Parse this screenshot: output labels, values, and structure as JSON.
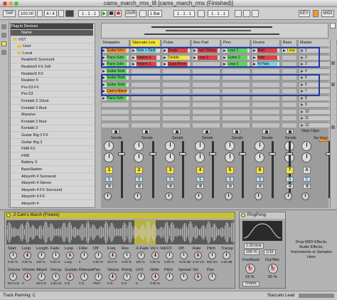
{
  "window": {
    "title": "cams_march_rmx_l8  [cams_march_rmx (Finished)]"
  },
  "control": {
    "tap": "TAP",
    "tempo": "100.00",
    "sig": "4 / 4",
    "pos": "1 . 1 . 1",
    "ovr": "OVR",
    "loop": "1 Bar",
    "pos2": "1 . 1 . 1",
    "key": "KEY",
    "midi": "MIDI",
    "pct": "%"
  },
  "browser": {
    "header": "Plug-in Devices",
    "items": [
      "Name",
      "VST",
      "User",
      "Local",
      "Reaktor5 Surround",
      "Reaktor5 FX 2x8",
      "Reaktor5 FX",
      "Reaktor 5",
      "Pro-53 FX",
      "Pro-53",
      "Kontakt 3 16out",
      "Kontakt 3 8out",
      "Massive",
      "Kontakt 3 8out",
      "Kontakt 3",
      "Guitar Rig 3 FX",
      "Guitar Rig 3",
      "FM8 FX",
      "FM8",
      "Battery 3",
      "BassStation",
      "Absynth 4 Surround",
      "Absynth 4 Stereo",
      "Absynth 4 FX Surround",
      "Absynth 4 FX",
      "Absynth 4"
    ]
  },
  "session": {
    "tracks": [
      "Smapples",
      "Staccato Lea",
      "Pulse",
      "Rev Pad",
      "Perc",
      "Drums",
      "Bass",
      "Master"
    ],
    "clips": [
      [
        "Guitar Intro",
        "Note + Stutt",
        "Single",
        "Fad / Delay",
        "Loop 1",
        "Main",
        "Loop 1",
        ""
      ],
      [
        "Piano Solo",
        "Pattern 3",
        "Double",
        "Loop 2",
        "Guitar 2",
        "Ride",
        "",
        ""
      ],
      [
        "Piano Solo",
        "Pattern 1",
        "Quad Reve",
        "",
        "Loop 2",
        "Hi Hats",
        "",
        ""
      ],
      [
        "Guitar Stutt",
        "",
        "",
        "",
        "",
        "",
        "",
        ""
      ],
      [
        "Guitar Stutt",
        "",
        "",
        "",
        "",
        "",
        "",
        ""
      ],
      [
        "Guitar Stutt",
        "",
        "",
        "",
        "",
        "",
        "",
        ""
      ],
      [
        "Cam's March",
        "",
        "",
        "",
        "",
        "",
        "",
        ""
      ],
      [
        "Piano Solo",
        "",
        "",
        "",
        "",
        "",
        "",
        ""
      ]
    ],
    "scenes": [
      "1",
      "2",
      "3",
      "4",
      "5",
      "6",
      "7",
      "8",
      "9",
      "10",
      "11",
      "12"
    ],
    "stop_clips": "Stop Clips",
    "sends": "Sends",
    "post": "Post",
    "track_numbers": [
      "1",
      "2",
      "3",
      "4",
      "5",
      "6",
      "7",
      "A"
    ],
    "solo": "S",
    "cue": "C"
  },
  "devices": {
    "clip_name": "2 Cam's March (Freeze)",
    "sampler": {
      "labels": [
        "Start",
        "Loop",
        "Length",
        "Fade",
        "Loop",
        "Filter",
        "Off",
        "Freq",
        "Res",
        "X-Fade",
        "Vol < Vel",
        "LFO",
        "Off",
        "Rate",
        "Pitch",
        "Transp",
        "Detune",
        "Volume",
        "Attack",
        "Decay",
        "Sustain",
        "Release",
        "Pan",
        "Voices",
        "Retrig",
        "LFO",
        "Glide",
        "Pitch",
        "Spread",
        "Vel",
        "Pan"
      ],
      "values": [
        "0.00 %",
        "0.00 %",
        "100 %",
        "0.00 %",
        "Loop",
        "6",
        "0.00 %",
        "20.0 %",
        "0.00 %",
        "100 %",
        "0.00 %",
        "0.00 %",
        "-0.00 dB",
        "0.10 ms",
        "600 ms",
        "0.00 dB",
        "50.0 ms",
        "C",
        "20.0 %",
        "1.00 Hz",
        "0 st",
        "0 ct",
        "Pitch",
        "0 st",
        "0 ct",
        "6",
        "0.00 %"
      ]
    },
    "pingpong": {
      "title": "PingPong",
      "freq": "1.00 kHz",
      "width": "100 %",
      "beat": "1/16",
      "labels": [
        "Feedback",
        "Dry/Wet"
      ],
      "values": [
        "19 %",
        "55 %"
      ],
      "freeze": "Freeze"
    },
    "drop_hint": "Drop MIDI Effects, Audio Effects, Instruments or Samples Here"
  },
  "status": {
    "text": "Track Panning: C",
    "track": "Staccato Lead"
  },
  "colors": {
    "orange": "#f39a2c",
    "yellow": "#f5e43a",
    "green": "#5fd35f",
    "cyan": "#7fd0e6",
    "blue": "#1f3aa8",
    "red": "#e04040",
    "violet": "#b08ad8"
  }
}
